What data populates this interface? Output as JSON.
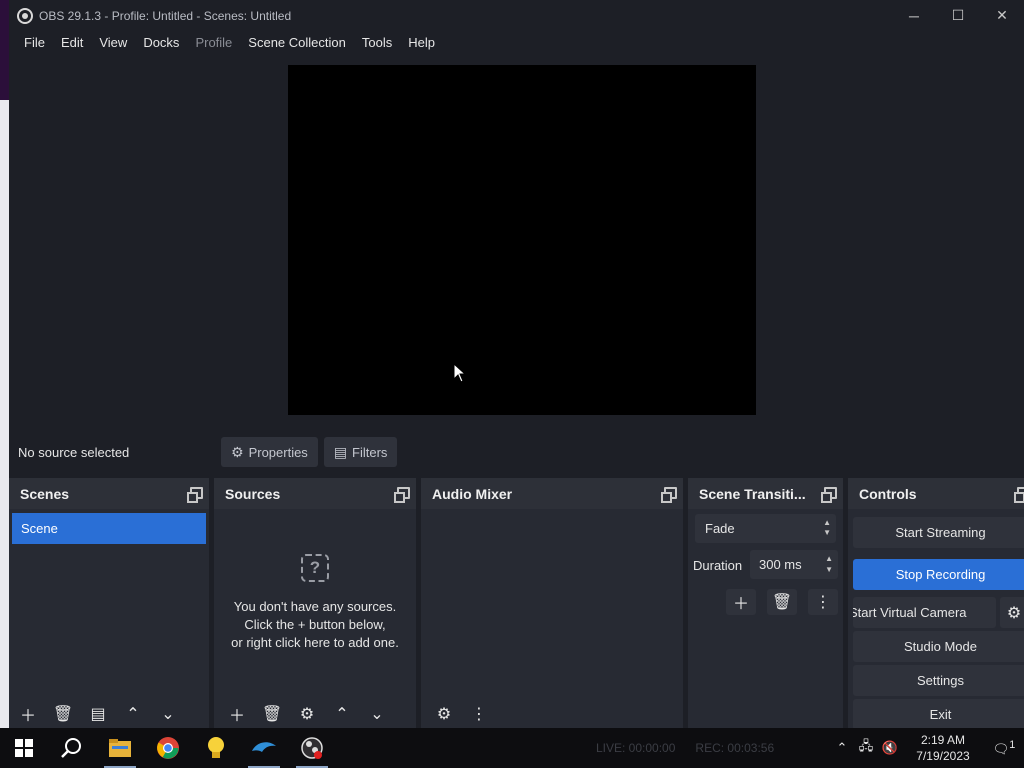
{
  "window": {
    "title": "OBS 29.1.3 - Profile: Untitled - Scenes: Untitled",
    "minimize_glyph": "─",
    "maximize_glyph": "☐",
    "close_glyph": "✕"
  },
  "menu": [
    "File",
    "Edit",
    "View",
    "Docks",
    "Profile",
    "Scene Collection",
    "Tools",
    "Help"
  ],
  "source_bar": {
    "status": "No source selected",
    "properties_label": "Properties",
    "filters_label": "Filters"
  },
  "docks": {
    "scenes": {
      "title": "Scenes",
      "items": [
        "Scene"
      ]
    },
    "sources": {
      "title": "Sources",
      "empty_line1": "You don't have any sources.",
      "empty_line2": "Click the + button below,",
      "empty_line3": "or right click here to add one."
    },
    "audio_mixer": {
      "title": "Audio Mixer"
    },
    "transitions": {
      "title": "Scene Transiti...",
      "selected": "Fade",
      "duration_label": "Duration",
      "duration_value": "300 ms"
    },
    "controls": {
      "title": "Controls",
      "start_streaming": "Start Streaming",
      "stop_recording": "Stop Recording",
      "start_virtual_camera": "Start Virtual Camera",
      "studio_mode": "Studio Mode",
      "settings": "Settings",
      "exit": "Exit"
    }
  },
  "statusbar": {
    "live": "LIVE: 00:00:00",
    "rec": "REC: 00:03:56"
  },
  "taskbar": {
    "time": "2:19 AM",
    "date": "7/19/2023",
    "notification_count": "1"
  },
  "icons": {
    "app": "obs-logo-icon",
    "colors": {
      "accent": "#2a6fd6",
      "dock_bg": "#272a33",
      "window_bg": "#1d1f26"
    }
  }
}
